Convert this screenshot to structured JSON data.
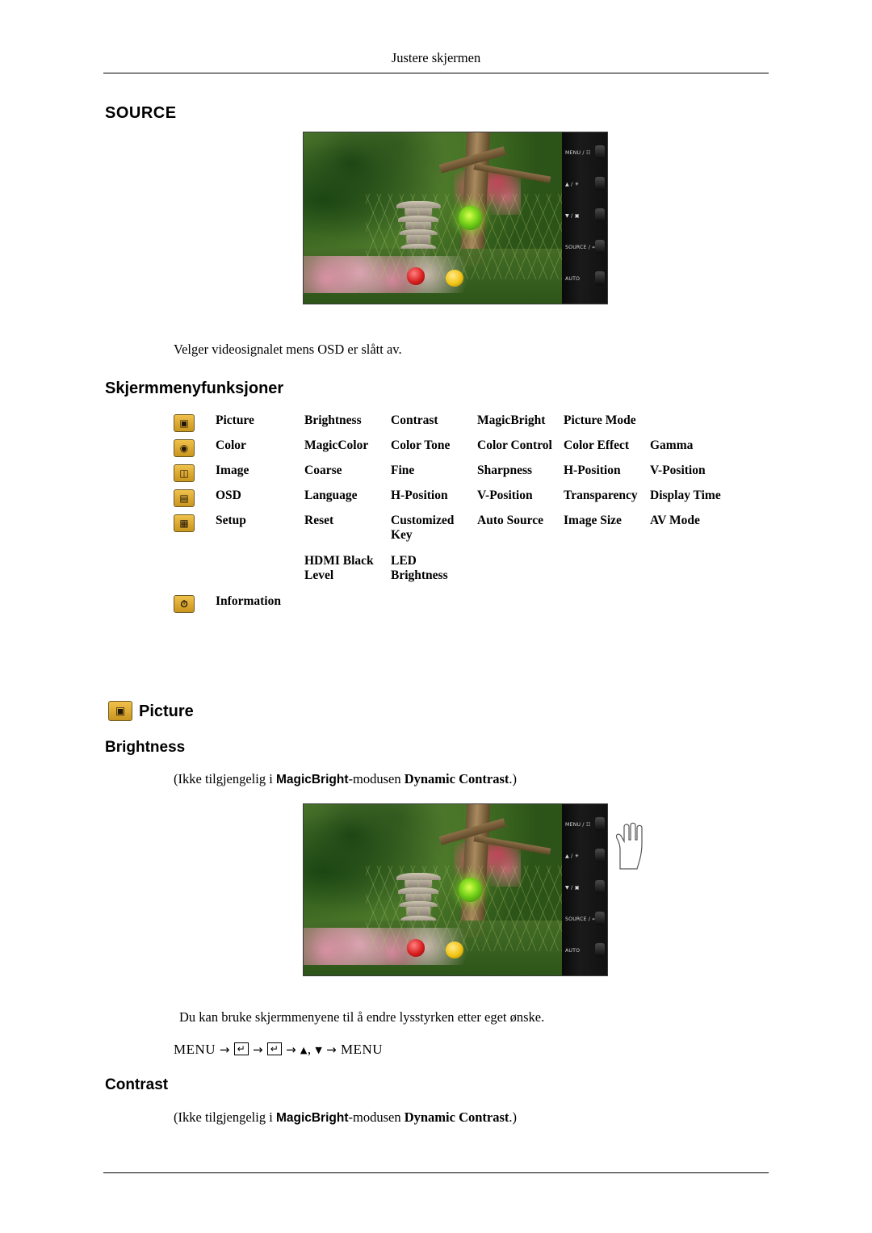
{
  "header": {
    "running_title": "Justere skjermen"
  },
  "sections": {
    "source_heading": "SOURCE",
    "source_caption": "Velger videosignalet mens OSD er slått av.",
    "osd_functions_heading": "Skjermmenyfunksjoner",
    "picture_heading": "Picture",
    "brightness_heading": "Brightness",
    "brightness_note_prefix": "(Ikke tilgjengelig i ",
    "brightness_note_bold1": "MagicBright",
    "brightness_note_mid": "-modusen ",
    "brightness_note_bold2": "Dynamic Contrast",
    "brightness_note_suffix": ".)",
    "brightness_caption": "Du kan bruke skjermmenyene til å endre lysstyrken etter eget ønske.",
    "contrast_heading": "Contrast",
    "contrast_note_prefix": "(Ikke tilgjengelig i ",
    "contrast_note_bold1": "MagicBright",
    "contrast_note_mid": "-modusen ",
    "contrast_note_bold2": "Dynamic Contrast",
    "contrast_note_suffix": ".)"
  },
  "menu_sequence": {
    "start": "MENU",
    "arrow": "→",
    "enter_key": "↵",
    "up_triangle": "▲",
    "comma": ",",
    "down_triangle": "▼",
    "end": "MENU"
  },
  "osd_table": {
    "rows": [
      {
        "icon": "picture-icon",
        "name": "Picture",
        "items": [
          "Brightness",
          "Contrast",
          "MagicBright",
          "Picture Mode"
        ]
      },
      {
        "icon": "color-icon",
        "name": "Color",
        "items": [
          "MagicColor",
          "Color Tone",
          "Color Control",
          "Color Effect",
          "Gamma"
        ]
      },
      {
        "icon": "image-icon",
        "name": "Image",
        "items": [
          "Coarse",
          "Fine",
          "Sharpness",
          "H-Position",
          "V-Position"
        ]
      },
      {
        "icon": "osd-icon",
        "name": "OSD",
        "items": [
          "Language",
          "H-Position",
          "V-Position",
          "Transparency",
          "Display Time"
        ]
      },
      {
        "icon": "setup-icon",
        "name": "Setup",
        "items": [
          "Reset",
          "Customized Key",
          "Auto Source",
          "Image Size",
          "AV Mode"
        ]
      },
      {
        "icon": "",
        "name": "",
        "items": [
          "HDMI Black Level",
          "LED Brightness"
        ]
      },
      {
        "icon": "information-icon",
        "name": "Information",
        "items": []
      }
    ]
  },
  "monitor_panel": {
    "buttons": [
      {
        "label": "MENU / ☷"
      },
      {
        "label": "▲ / ☀"
      },
      {
        "label": "▼ / ▣"
      },
      {
        "label": "SOURCE / ↵"
      },
      {
        "label": "AUTO"
      }
    ]
  }
}
